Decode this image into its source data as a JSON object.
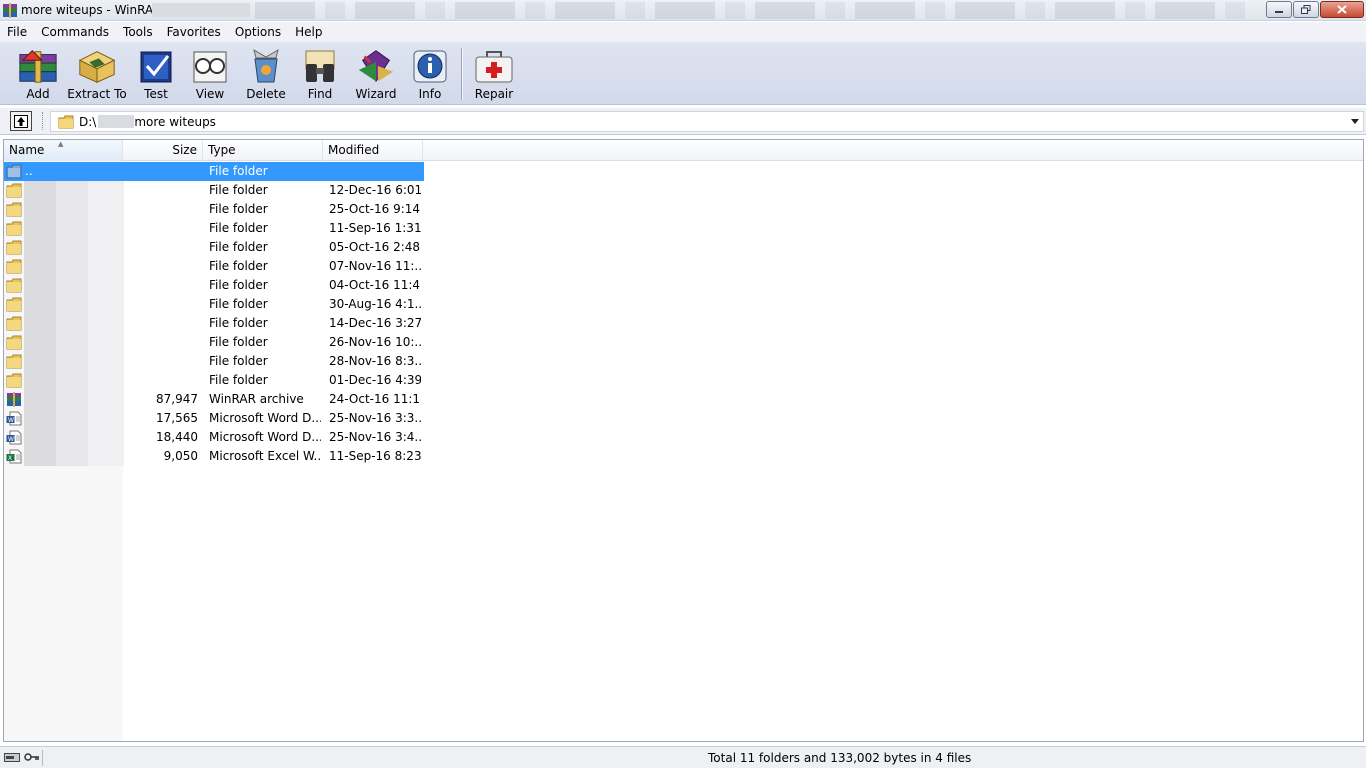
{
  "window": {
    "title": "more witeups - WinRAR",
    "colors": {
      "selection": "#3399ff",
      "toolbar": "#d6dcec",
      "close_button": "#c64a33"
    }
  },
  "menu": [
    "File",
    "Commands",
    "Tools",
    "Favorites",
    "Options",
    "Help"
  ],
  "toolbar": {
    "buttons": [
      {
        "label": "Add",
        "icon": "add-archive-icon"
      },
      {
        "label": "Extract To",
        "icon": "extract-icon"
      },
      {
        "label": "Test",
        "icon": "test-icon"
      },
      {
        "label": "View",
        "icon": "view-icon"
      },
      {
        "label": "Delete",
        "icon": "delete-icon"
      },
      {
        "label": "Find",
        "icon": "find-binoculars-icon"
      },
      {
        "label": "Wizard",
        "icon": "wizard-icon"
      },
      {
        "label": "Info",
        "icon": "info-icon"
      },
      {
        "label": "Repair",
        "icon": "repair-kit-icon"
      }
    ]
  },
  "address": {
    "prefix": "D:\\",
    "suffix": "more witeups"
  },
  "list": {
    "columns": {
      "name": "Name",
      "size": "Size",
      "type": "Type",
      "modified": "Modified"
    },
    "rows": [
      {
        "name": "..",
        "size": "",
        "type": "File folder",
        "modified": "",
        "icon": "parent-folder-icon",
        "selected": true
      },
      {
        "name": "",
        "size": "",
        "type": "File folder",
        "modified": "12-Dec-16 6:01...",
        "icon": "folder-icon"
      },
      {
        "name": "",
        "size": "",
        "type": "File folder",
        "modified": "25-Oct-16 9:14...",
        "icon": "folder-icon"
      },
      {
        "name": "",
        "size": "",
        "type": "File folder",
        "modified": "11-Sep-16 1:31...",
        "icon": "folder-icon"
      },
      {
        "name": "",
        "size": "",
        "type": "File folder",
        "modified": "05-Oct-16 2:48...",
        "icon": "folder-icon"
      },
      {
        "name": "",
        "size": "",
        "type": "File folder",
        "modified": "07-Nov-16 11:...",
        "icon": "folder-icon"
      },
      {
        "name": "",
        "size": "",
        "type": "File folder",
        "modified": "04-Oct-16 11:4...",
        "icon": "folder-icon"
      },
      {
        "name": "",
        "size": "",
        "type": "File folder",
        "modified": "30-Aug-16 4:1...",
        "icon": "folder-icon"
      },
      {
        "name": "",
        "size": "",
        "type": "File folder",
        "modified": "14-Dec-16 3:27...",
        "icon": "folder-icon"
      },
      {
        "name": "",
        "size": "",
        "type": "File folder",
        "modified": "26-Nov-16 10:...",
        "icon": "folder-icon"
      },
      {
        "name": "",
        "size": "",
        "type": "File folder",
        "modified": "28-Nov-16 8:3...",
        "icon": "folder-icon"
      },
      {
        "name": "",
        "size": "",
        "type": "File folder",
        "modified": "01-Dec-16 4:39...",
        "icon": "folder-icon"
      },
      {
        "name": "",
        "size": "87,947",
        "type": "WinRAR archive",
        "modified": "24-Oct-16 11:1...",
        "icon": "winrar-archive-icon"
      },
      {
        "name": "",
        "size": "17,565",
        "type": "Microsoft Word D...",
        "modified": "25-Nov-16 3:3...",
        "icon": "word-document-icon"
      },
      {
        "name": "",
        "size": "18,440",
        "type": "Microsoft Word D...",
        "modified": "25-Nov-16 3:4...",
        "icon": "word-document-icon"
      },
      {
        "name": "",
        "size": "9,050",
        "type": "Microsoft Excel W...",
        "modified": "11-Sep-16 8:23...",
        "icon": "excel-workbook-icon"
      }
    ]
  },
  "status": {
    "text": "Total 11 folders and 133,002 bytes in 4 files"
  }
}
